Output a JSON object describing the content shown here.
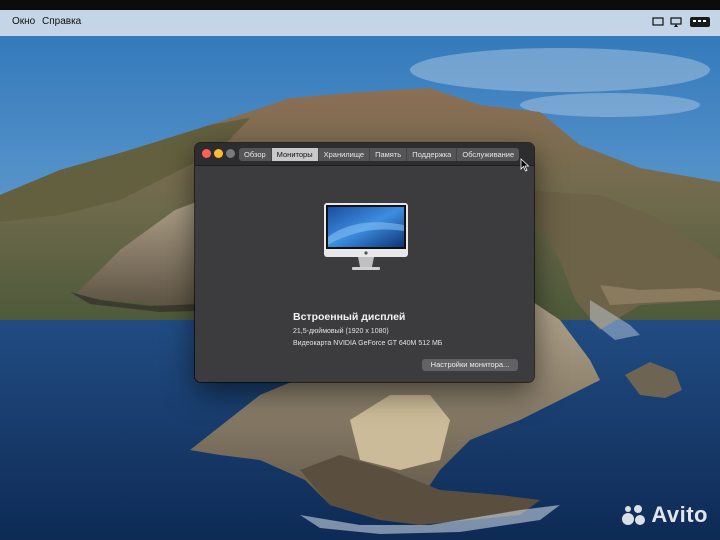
{
  "menubar": {
    "items": [
      "Окно",
      "Справка"
    ],
    "tray_icons": [
      "display-icon",
      "screen-mirroring-icon",
      "keyboard-layout-icon"
    ]
  },
  "window": {
    "tabs": [
      "Обзор",
      "Мониторы",
      "Хранилище",
      "Память",
      "Поддержка",
      "Обслуживание"
    ],
    "active_tab": "Мониторы",
    "display_name": "Встроенный дисплей",
    "resolution": "21,5-дюймовый (1920 x 1080)",
    "graphics": "Видеокарта NVIDIA GeForce GT 640M 512 МБ",
    "button_label": "Настройки монитора..."
  },
  "watermark": {
    "text": "Avito"
  },
  "colors": {
    "window_bg": "#3c3c3e",
    "active_tab": "#c9c9cb",
    "traffic_close": "#fe5f57",
    "traffic_minimize": "#febc2e",
    "traffic_zoom": "#7a7a7a"
  }
}
